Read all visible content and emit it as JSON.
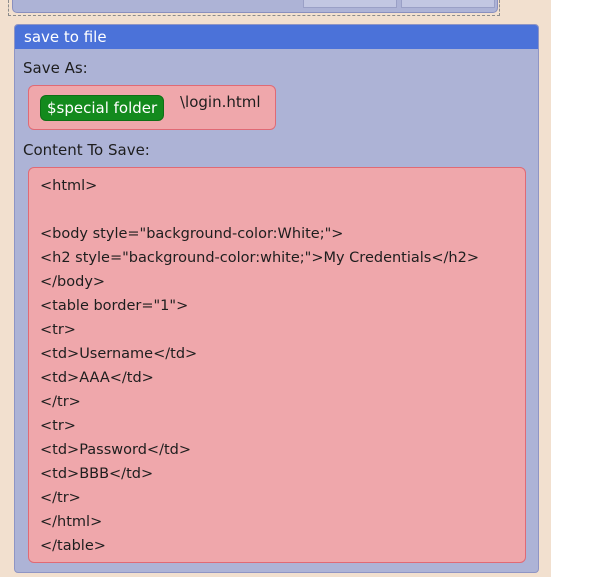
{
  "card": {
    "header_title": "save to file"
  },
  "save_as": {
    "label": "Save As:",
    "variable_pill": "$special folder",
    "path": "\\login.html"
  },
  "content": {
    "label": "Content To Save:",
    "lines": [
      "<html>",
      "",
      "<body style=\"background-color:White;\">",
      "<h2 style=\"background-color:white;\">My Credentials</h2>",
      "</body>",
      "<table border=\"1\">",
      "<tr>",
      "<td>Username</td>",
      "<td>AAA</td>",
      "</tr>",
      "<tr>",
      "<td>Password</td>",
      "<td>BBB</td>",
      "</tr>",
      "</html>",
      "</table>"
    ]
  },
  "colors": {
    "header": "#4b72d9",
    "panel": "#adb3d6",
    "field_fill": "#efa7ab",
    "field_border": "#e06a75",
    "pill": "#138a1d",
    "background": "#f2e0cf"
  }
}
